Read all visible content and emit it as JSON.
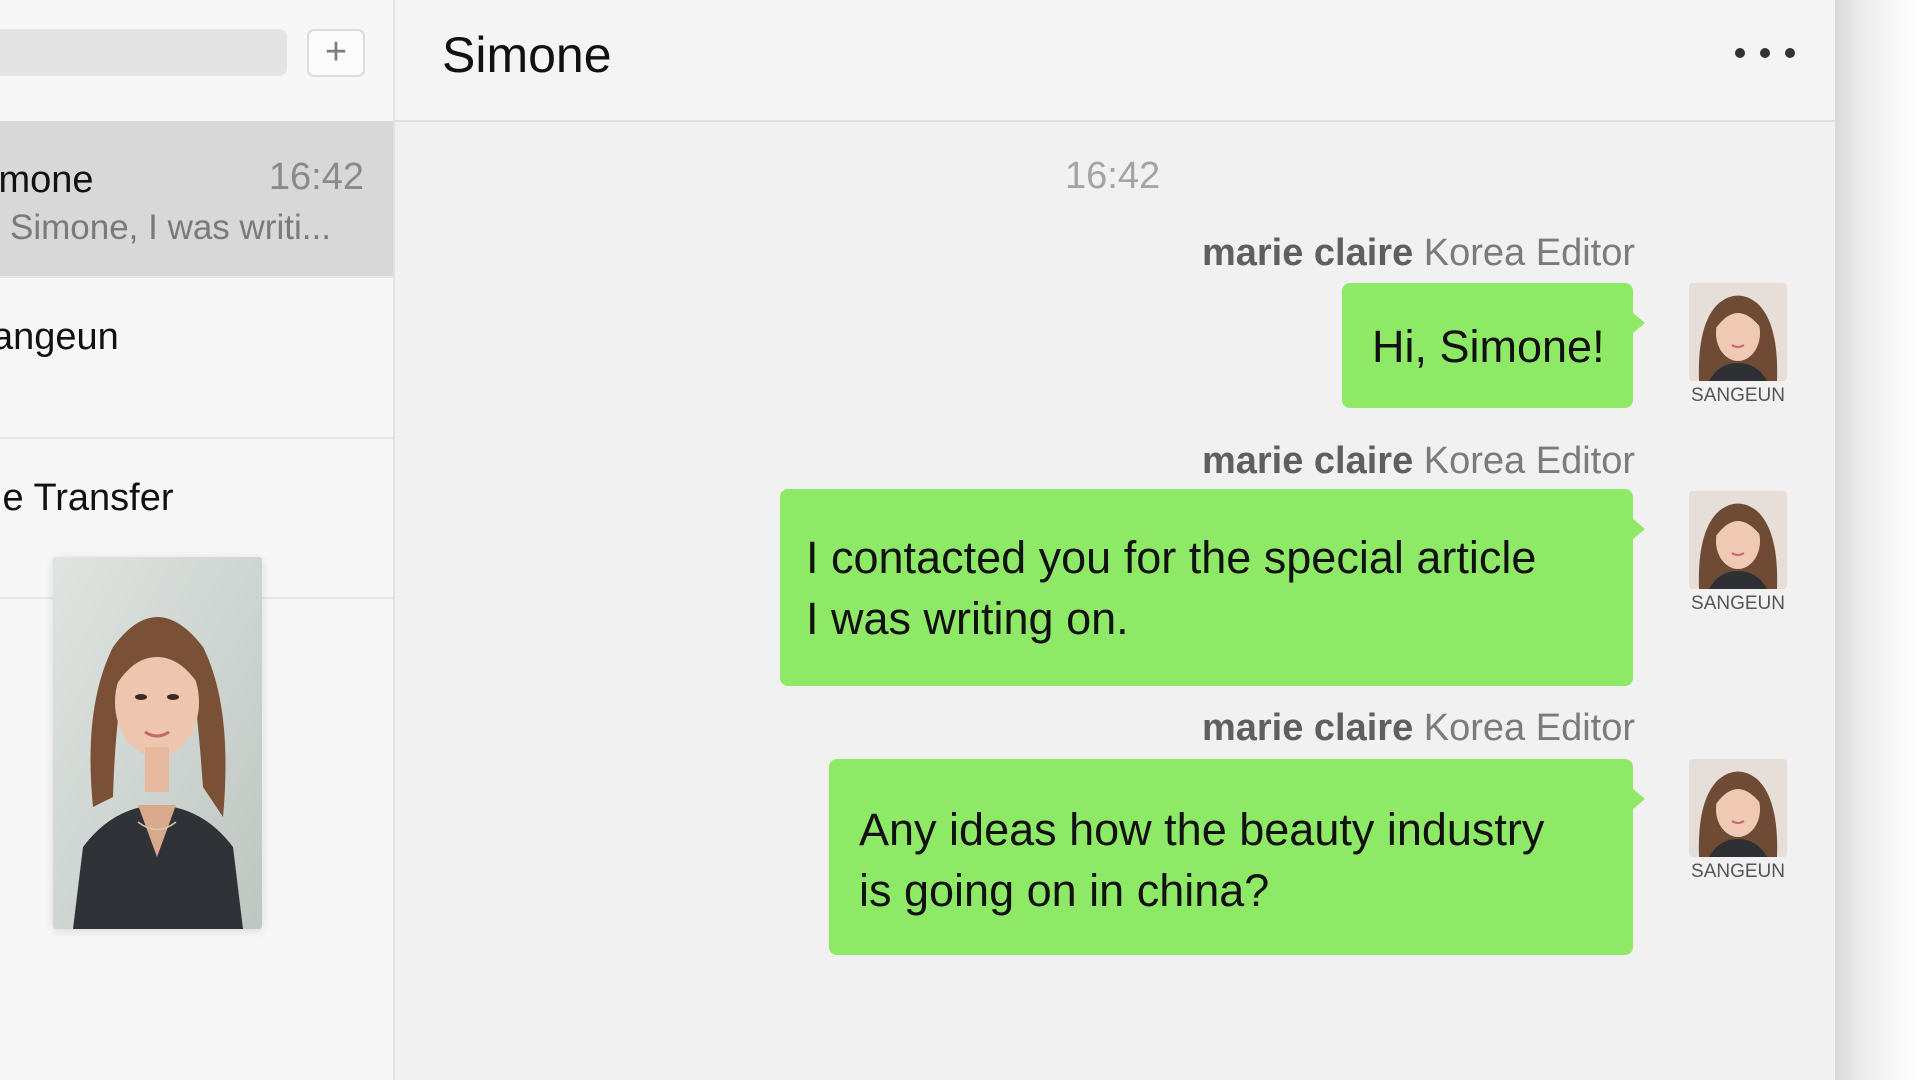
{
  "sidebar": {
    "add_label": "+",
    "chats": [
      {
        "name": "imone",
        "time": "16:42",
        "preview": "Simone, I was writi..."
      },
      {
        "name": "angeun"
      },
      {
        "name": "le Transfer"
      }
    ]
  },
  "conversation": {
    "title": "Simone",
    "timestamp": "16:42",
    "messages": [
      {
        "sender_brand": "marie claire",
        "sender_role": " Korea Editor",
        "lines": [
          "Hi, Simone!"
        ],
        "avatar_label": "SANGEUN"
      },
      {
        "sender_brand": "marie claire",
        "sender_role": " Korea Editor",
        "lines": [
          "I contacted you for the special article",
          "I was writing on."
        ],
        "avatar_label": "SANGEUN"
      },
      {
        "sender_brand": "marie claire",
        "sender_role": " Korea Editor",
        "lines": [
          "Any ideas how the beauty industry",
          "is going on in china?"
        ],
        "avatar_label": "SANGEUN"
      }
    ]
  },
  "colors": {
    "bubble": "#8ee966",
    "active_chat": "#d8d8d8"
  }
}
